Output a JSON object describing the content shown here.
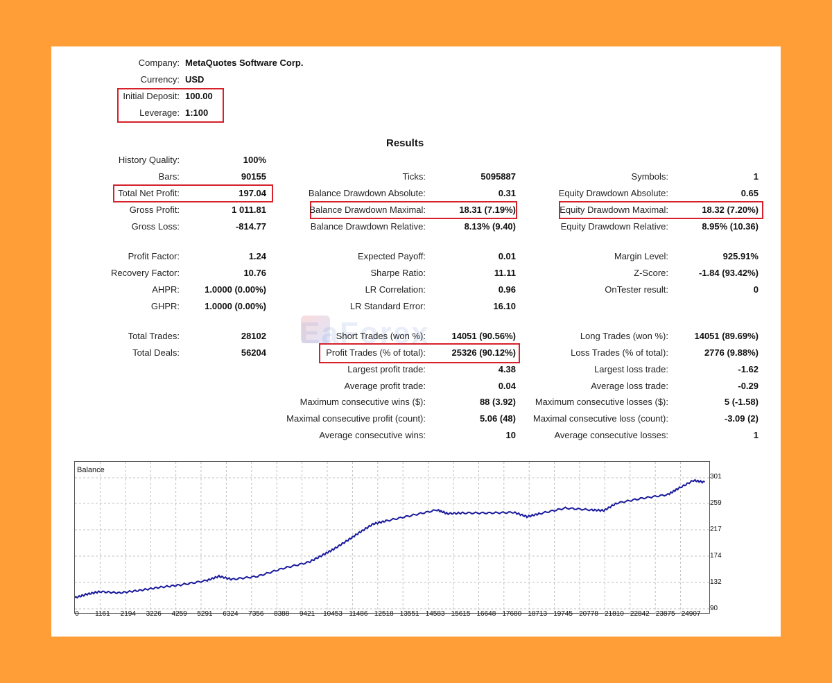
{
  "header": {
    "company_label": "Company:",
    "company_value": "MetaQuotes Software Corp.",
    "currency_label": "Currency:",
    "currency_value": "USD",
    "deposit_label": "Initial Deposit:",
    "deposit_value": "100.00",
    "leverage_label": "Leverage:",
    "leverage_value": "1:100"
  },
  "results_title": "Results",
  "col1": [
    {
      "label": "History Quality:",
      "value": "100%"
    },
    {
      "label": "Bars:",
      "value": "90155"
    },
    {
      "label": "Total Net Profit:",
      "value": "197.04"
    },
    {
      "label": "Gross Profit:",
      "value": "1 011.81"
    },
    {
      "label": "Gross Loss:",
      "value": "-814.77"
    },
    {
      "label": "Profit Factor:",
      "value": "1.24"
    },
    {
      "label": "Recovery Factor:",
      "value": "10.76"
    },
    {
      "label": "AHPR:",
      "value": "1.0000 (0.00%)"
    },
    {
      "label": "GHPR:",
      "value": "1.0000 (0.00%)"
    },
    {
      "label": "Total Trades:",
      "value": "28102"
    },
    {
      "label": "Total Deals:",
      "value": "56204"
    }
  ],
  "col2": [
    {
      "label": "Ticks:",
      "value": "5095887"
    },
    {
      "label": "Balance Drawdown Absolute:",
      "value": "0.31"
    },
    {
      "label": "Balance Drawdown Maximal:",
      "value": "18.31 (7.19%)"
    },
    {
      "label": "Balance Drawdown Relative:",
      "value": "8.13% (9.40)"
    },
    {
      "label": "Expected Payoff:",
      "value": "0.01"
    },
    {
      "label": "Sharpe Ratio:",
      "value": "11.11"
    },
    {
      "label": "LR Correlation:",
      "value": "0.96"
    },
    {
      "label": "LR Standard Error:",
      "value": "16.10"
    },
    {
      "label": "Short Trades (won %):",
      "value": "14051 (90.56%)"
    },
    {
      "label": "Profit Trades (% of total):",
      "value": "25326 (90.12%)"
    },
    {
      "label": "Largest profit trade:",
      "value": "4.38"
    },
    {
      "label": "Average profit trade:",
      "value": "0.04"
    },
    {
      "label": "Maximum consecutive wins ($):",
      "value": "88 (3.92)"
    },
    {
      "label": "Maximal consecutive profit (count):",
      "value": "5.06 (48)"
    },
    {
      "label": "Average consecutive wins:",
      "value": "10"
    }
  ],
  "col3": [
    {
      "label": "Symbols:",
      "value": "1"
    },
    {
      "label": "Equity Drawdown Absolute:",
      "value": "0.65"
    },
    {
      "label": "Equity Drawdown Maximal:",
      "value": "18.32 (7.20%)"
    },
    {
      "label": "Equity Drawdown Relative:",
      "value": "8.95% (10.36)"
    },
    {
      "label": "Margin Level:",
      "value": "925.91%"
    },
    {
      "label": "Z-Score:",
      "value": "-1.84 (93.42%)"
    },
    {
      "label": "OnTester result:",
      "value": "0"
    },
    {
      "label": "Long Trades (won %):",
      "value": "14051 (89.69%)"
    },
    {
      "label": "Loss Trades (% of total):",
      "value": "2776 (9.88%)"
    },
    {
      "label": "Largest loss trade:",
      "value": "-1.62"
    },
    {
      "label": "Average loss trade:",
      "value": "-0.29"
    },
    {
      "label": "Maximum consecutive losses ($):",
      "value": "5 (-1.58)"
    },
    {
      "label": "Maximal consecutive loss (count):",
      "value": "-3.09 (2)"
    },
    {
      "label": "Average consecutive losses:",
      "value": "1"
    }
  ],
  "watermark": "EaForex",
  "colors": {
    "background": "#FF9D36",
    "highlight": "#D6202A",
    "line": "#1A1A9C",
    "grid": "#BFBFBF"
  },
  "chart_data": {
    "type": "line",
    "title": "Balance",
    "x_ticks": [
      "0",
      "1161",
      "2194",
      "3226",
      "4259",
      "5291",
      "6324",
      "7356",
      "8388",
      "9421",
      "10453",
      "11486",
      "12518",
      "13551",
      "14583",
      "15615",
      "16648",
      "17680",
      "18713",
      "19745",
      "20778",
      "21810",
      "22842",
      "23875",
      "24907"
    ],
    "y_ticks": [
      "301",
      "259",
      "217",
      "174",
      "132",
      "90"
    ],
    "ylim": [
      90,
      310
    ],
    "xlim": [
      0,
      25400
    ],
    "series": [
      {
        "x": [
          0,
          500,
          1000,
          1800,
          2600,
          3400,
          4259,
          5291,
          5800,
          6324,
          7356,
          8388,
          9421,
          10000,
          10453,
          11000,
          11486,
          12000,
          12518,
          13551,
          14583,
          15000,
          15615,
          16648,
          17680,
          18200,
          18713,
          19745,
          20778,
          21300,
          21810,
          22842,
          23875,
          24300,
          24907,
          25350
        ],
        "values": [
          100,
          106,
          110,
          108,
          112,
          117,
          121,
          128,
          135,
          130,
          135,
          148,
          158,
          170,
          180,
          194,
          207,
          220,
          225,
          234,
          243,
          237,
          238,
          238,
          239,
          232,
          237,
          246,
          243,
          242,
          254,
          262,
          268,
          278,
          291,
          288
        ]
      }
    ]
  }
}
